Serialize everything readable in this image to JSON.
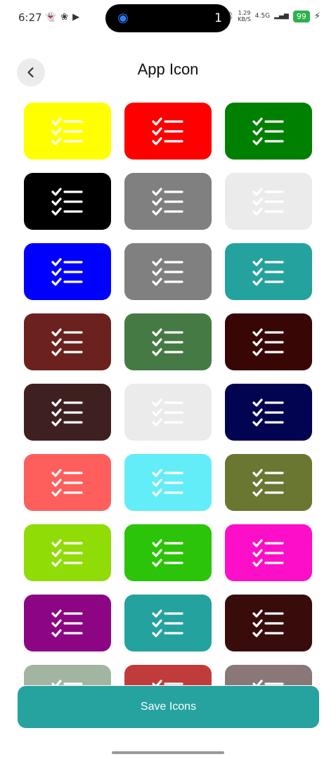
{
  "status_bar": {
    "time": "6:27",
    "left_icons": [
      "snapchat-icon",
      "pinwheel-icon",
      "youtube-icon"
    ],
    "island_count": "1",
    "net_speed_top": "1.29",
    "net_speed_bottom": "KB/S",
    "network": "4.5G",
    "battery": "99"
  },
  "header": {
    "title": "App Icon",
    "back_icon": "chevron-left-icon"
  },
  "icon_grid": {
    "glyph": "checklist-icon",
    "tiles": [
      {
        "color": "#ffff00"
      },
      {
        "color": "#ff0000"
      },
      {
        "color": "#008000"
      },
      {
        "color": "#000000"
      },
      {
        "color": "#808080"
      },
      {
        "color": "#ebebeb"
      },
      {
        "color": "#0000ff"
      },
      {
        "color": "#808080"
      },
      {
        "color": "#24a29e"
      },
      {
        "color": "#6b211d"
      },
      {
        "color": "#467a44"
      },
      {
        "color": "#390606"
      },
      {
        "color": "#3f2020"
      },
      {
        "color": "#ebebeb"
      },
      {
        "color": "#020452"
      },
      {
        "color": "#fe5f5c"
      },
      {
        "color": "#63edf8"
      },
      {
        "color": "#6a7731"
      },
      {
        "color": "#90dc06"
      },
      {
        "color": "#2cc408"
      },
      {
        "color": "#fd0ec8"
      },
      {
        "color": "#8c0684"
      },
      {
        "color": "#24a29e"
      },
      {
        "color": "#390c0c"
      },
      {
        "color": "#a2b5a0"
      },
      {
        "color": "#c03c3c"
      },
      {
        "color": "#8a7878"
      }
    ]
  },
  "save_button": {
    "label": "Save Icons"
  }
}
